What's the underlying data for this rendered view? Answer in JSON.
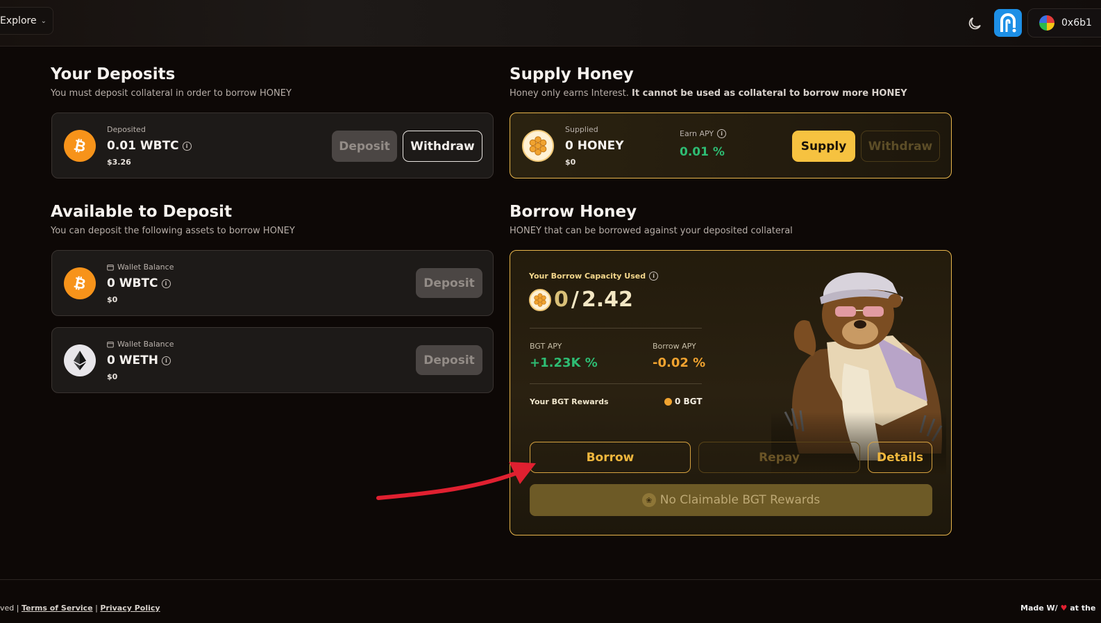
{
  "topbar": {
    "explore_label": "Explore",
    "wallet_address": "0x6b1"
  },
  "deposits": {
    "title": "Your Deposits",
    "subtitle": "You must deposit collateral in order to borrow HONEY",
    "card": {
      "label": "Deposited",
      "amount": "0.01 WBTC",
      "usd": "$3.26",
      "deposit_label": "Deposit",
      "withdraw_label": "Withdraw"
    }
  },
  "supply": {
    "title": "Supply Honey",
    "subtitle_plain": "Honey only earns Interest.",
    "subtitle_bold": "It cannot be used as collateral to borrow more HONEY",
    "card": {
      "label": "Supplied",
      "amount": "0 HONEY",
      "usd": "$0",
      "apy_label": "Earn APY",
      "apy_value": "0.01 %",
      "supply_label": "Supply",
      "withdraw_label": "Withdraw"
    }
  },
  "available": {
    "title": "Available to Deposit",
    "subtitle": "You can deposit the following assets to borrow HONEY",
    "items": [
      {
        "label": "Wallet Balance",
        "amount": "0 WBTC",
        "usd": "$0",
        "button": "Deposit"
      },
      {
        "label": "Wallet Balance",
        "amount": "0 WETH",
        "usd": "$0",
        "button": "Deposit"
      }
    ]
  },
  "borrow": {
    "title": "Borrow Honey",
    "subtitle": "HONEY that can be borrowed against your deposited collateral",
    "capacity_label": "Your Borrow Capacity Used",
    "capacity_used": "0",
    "capacity_total": "2.42",
    "bgt_apy_label": "BGT APY",
    "bgt_apy_value": "+1.23K %",
    "borrow_apy_label": "Borrow APY",
    "borrow_apy_value": "-0.02 %",
    "rewards_label": "Your BGT Rewards",
    "rewards_value": "0 BGT",
    "borrow_button": "Borrow",
    "repay_button": "Repay",
    "details_button": "Details",
    "claim_button": "No Claimable BGT Rewards"
  },
  "footer": {
    "left_prefix": "ved |",
    "terms": "Terms of Service",
    "separator": "|",
    "privacy": "Privacy Policy",
    "right_text": "Made W/",
    "right_suffix": "at the"
  },
  "colors": {
    "accent_gold": "#e9b64c",
    "btc_orange": "#f7931a",
    "positive_green": "#2ebc73",
    "negative_orange": "#f0a330",
    "arrow_red": "#e02030"
  }
}
